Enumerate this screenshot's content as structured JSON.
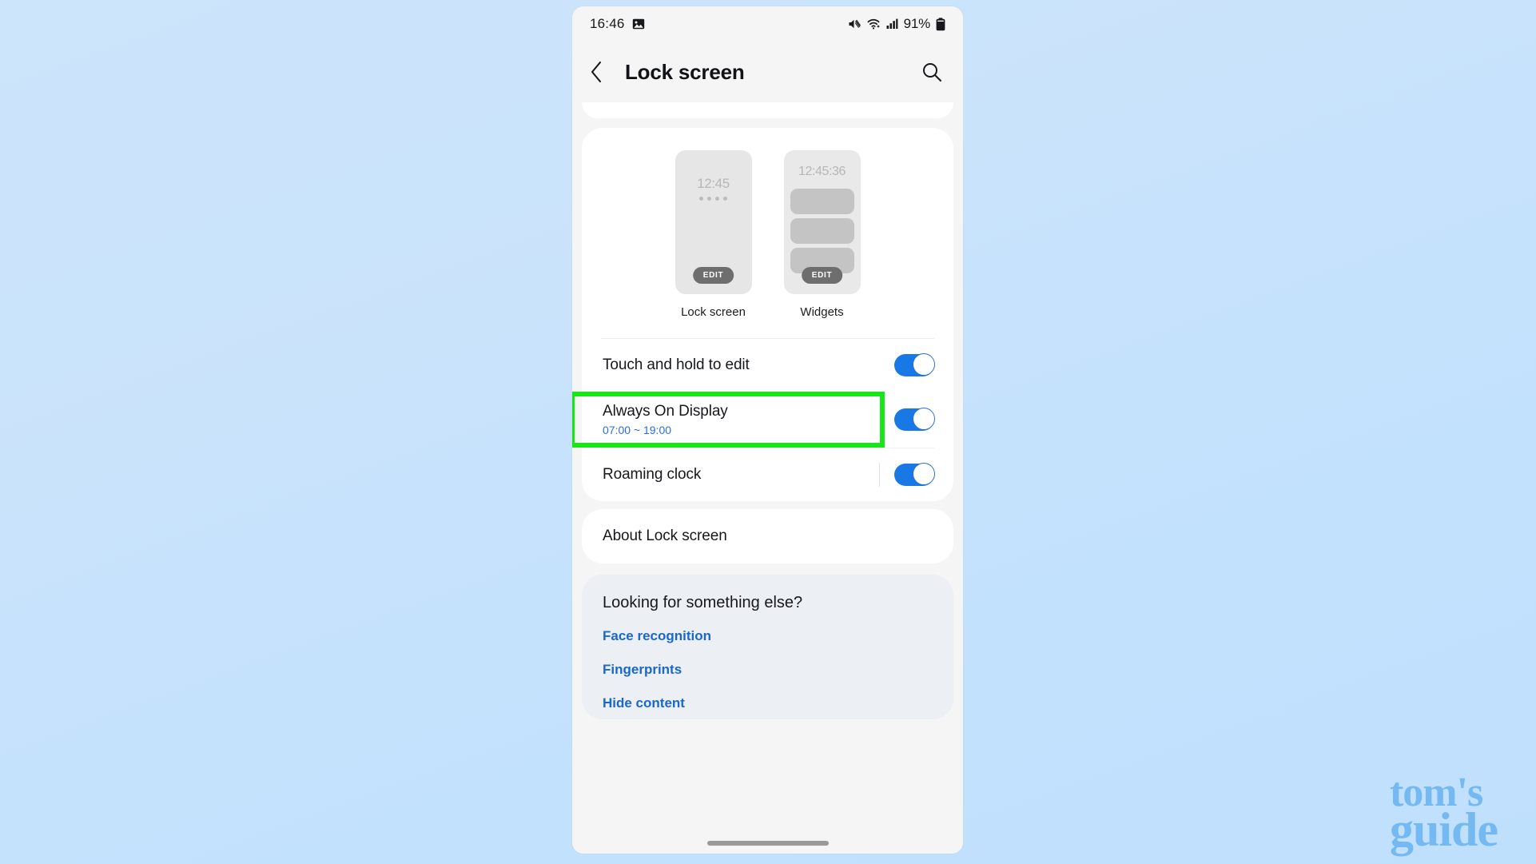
{
  "watermark": {
    "line1": "tom's",
    "line2": "guide"
  },
  "statusbar": {
    "time": "16:46",
    "left_icons": [
      "image-icon"
    ],
    "right_icons": [
      "mute-icon",
      "wifi-icon",
      "signal-icon"
    ],
    "battery_percent": "91%"
  },
  "appbar": {
    "back_icon": "chevron-left-icon",
    "title": "Lock screen",
    "search_icon": "search-icon"
  },
  "previews": [
    {
      "name": "lock-screen",
      "label": "Lock screen",
      "time": "12:45",
      "edit_label": "EDIT",
      "dots": 4
    },
    {
      "name": "widgets",
      "label": "Widgets",
      "time": "12:45:36",
      "edit_label": "EDIT",
      "bars": 3
    }
  ],
  "settings": [
    {
      "title": "Touch and hold to edit",
      "subtitle": "",
      "toggle": "on",
      "highlighted": false,
      "divider": false
    },
    {
      "title": "Always On Display",
      "subtitle": "07:00 ~ 19:00",
      "toggle": "on",
      "highlighted": true,
      "divider": false
    },
    {
      "title": "Roaming clock",
      "subtitle": "",
      "toggle": "on",
      "highlighted": false,
      "divider": true
    }
  ],
  "about": {
    "label": "About Lock screen"
  },
  "looking_for": {
    "title": "Looking for something else?",
    "links": [
      "Face recognition",
      "Fingerprints",
      "Hide content"
    ]
  },
  "colors": {
    "toggle_on": "#1878e6",
    "link": "#1a68cc",
    "highlight": "#19e619",
    "background": "#cde5fb"
  }
}
